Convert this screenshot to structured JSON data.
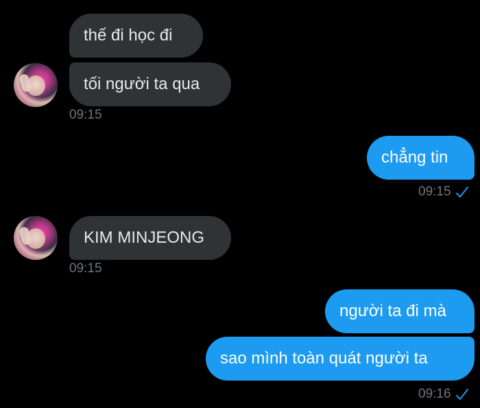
{
  "colors": {
    "background": "#000000",
    "incoming_bubble": "#2f3336",
    "outgoing_bubble": "#1d9bf0",
    "timestamp": "#71767b",
    "read_check": "#1d9bf0"
  },
  "messages": [
    {
      "id": "m1",
      "sender": "other",
      "text": "thế đi học đi"
    },
    {
      "id": "m2",
      "sender": "other",
      "text": "tối người ta qua"
    },
    {
      "id": "t1",
      "sender": "other",
      "time": "09:15"
    },
    {
      "id": "m3",
      "sender": "me",
      "text": "chẳng tin"
    },
    {
      "id": "t2",
      "sender": "me",
      "time": "09:15",
      "status_icon": "check-icon"
    },
    {
      "id": "m4",
      "sender": "other",
      "text": "KIM MINJEONG"
    },
    {
      "id": "t3",
      "sender": "other",
      "time": "09:15"
    },
    {
      "id": "m5",
      "sender": "me",
      "text": "người ta đi mà"
    },
    {
      "id": "m6",
      "sender": "me",
      "text": "sao mình toàn quát người ta"
    },
    {
      "id": "t4",
      "sender": "me",
      "time": "09:16",
      "status_icon": "check-icon"
    }
  ]
}
